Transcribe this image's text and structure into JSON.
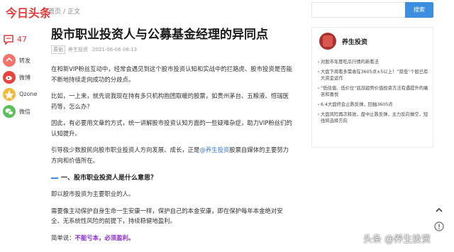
{
  "header": {
    "logo": "今日头条",
    "breadcrumb": [
      "首页",
      "正文"
    ],
    "search": {
      "placeholder": "",
      "button_label": "搜索"
    }
  },
  "share_rail": {
    "comment_count": "47",
    "items": [
      {
        "label": "转发",
        "icon": "repost-icon",
        "color": "#f2736b"
      },
      {
        "label": "微博",
        "icon": "weibo-icon",
        "color": "#e8443d"
      },
      {
        "label": "Qzone",
        "icon": "qzone-icon",
        "color": "#f5b93a"
      },
      {
        "label": "微信",
        "icon": "wechat-icon",
        "color": "#5cc05a"
      }
    ]
  },
  "article": {
    "title": "股市职业投资人与公募基金经理的异同点",
    "tag": "原创",
    "author": "养生投资",
    "datetime": "2021-06-06 08:13",
    "p1": "在和新VIP粉丝互动中，经常会遇见到这个股市投资认知和实战中的拦路虎、股市投资是否能不断地持续走向成功的分歧点。",
    "p2": "比如，一上来，就先说我现在持有多只机构抱团取暖的股票，如贵州茅台、五粮液、恒瑞医药等，怎么办？",
    "p3": "因此，有必要用文章的方式，统一讲解股市投资认知方面的一些疑难杂症，助力VIP粉丝们的认知提升。",
    "p4_pre": "引导极少数股民向股市职业投资人方向发展、成长，正是",
    "p4_link": "@养生投资",
    "p4_post": "股票自媒体的主要努力方向和价值所在。",
    "h1": "一、股市职业投资人是什么意思？",
    "p5": "即以股市投资为主要职业的人。",
    "p6": "需要像主动保护自身生命一生安康一样，保护自己的本金安康，即在保护每年本金绝对安全、无系统性风险的前提下，持续稳健地盈利。",
    "p7_pre": "简单说：",
    "p7_hl": "不能亏本，必须盈利。"
  },
  "sidebar": {
    "author_name": "养生投资",
    "items": [
      "对股市年度吃瓜行情的新看法",
      "大盘下周看多需收在3605点±5以上！“双低”个股已有大资金运作",
      "“低估值、低价位”底部趋势价值投资方法有遇提升的痛苦和喜悦",
      "6.4大盘终会止跌反弹，回抽3605点",
      "大盘风险再次释放，盘中止跌反弹，主力反向做空，短线将选择方向"
    ]
  },
  "watermark": "头条 @养生投资",
  "colors": {
    "brand": "#e03a3a",
    "accent": "#3c8fe0",
    "link": "#3a7bd5",
    "highlight": "#8a2bd3"
  }
}
